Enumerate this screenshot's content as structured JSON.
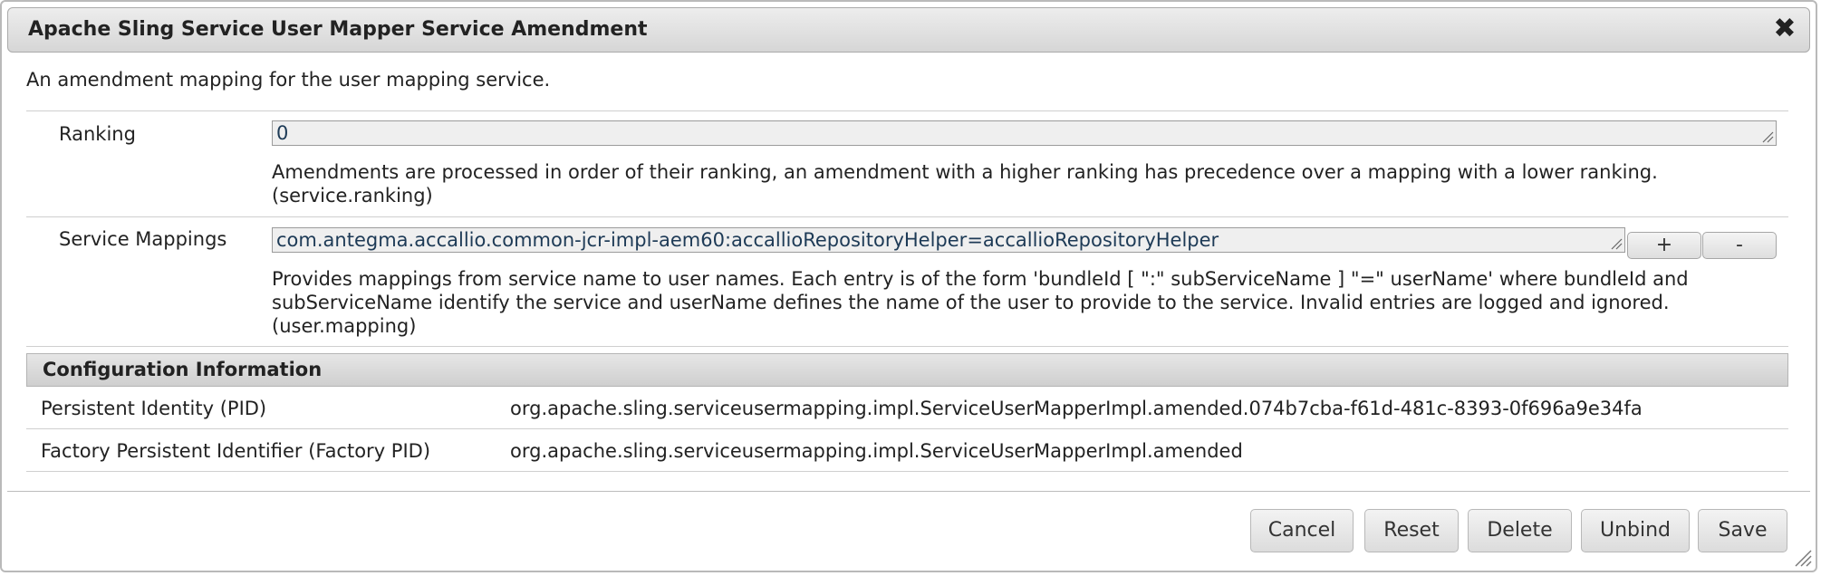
{
  "dialog": {
    "title": "Apache Sling Service User Mapper Service Amendment",
    "close_glyph": "✖",
    "description": "An amendment mapping for the user mapping service."
  },
  "ranking": {
    "label": "Ranking",
    "value": "0",
    "help_line1": "Amendments are processed in order of their ranking, an amendment with a higher ranking has precedence over a mapping with a lower ranking.",
    "help_line2": "(service.ranking)"
  },
  "service_mappings": {
    "label": "Service Mappings",
    "value": "com.antegma.accallio.common-jcr-impl-aem60:accallioRepositoryHelper=accallioRepositoryHelper",
    "add_label": "+",
    "remove_label": "-",
    "help_line1": "Provides mappings from service name to user names. Each entry is of the form 'bundleId [ \":\" subServiceName ] \"=\" userName' where bundleId and",
    "help_line2": "subServiceName identify the service and userName defines the name of the user to provide to the service. Invalid entries are logged and ignored.",
    "help_line3": "(user.mapping)"
  },
  "config_info": {
    "title": "Configuration Information",
    "pid_label": "Persistent Identity (PID)",
    "pid_value": "org.apache.sling.serviceusermapping.impl.ServiceUserMapperImpl.amended.074b7cba-f61d-481c-8393-0f696a9e34fa",
    "factory_pid_label": "Factory Persistent Identifier (Factory PID)",
    "factory_pid_value": "org.apache.sling.serviceusermapping.impl.ServiceUserMapperImpl.amended"
  },
  "buttons": {
    "cancel": "Cancel",
    "reset": "Reset",
    "delete": "Delete",
    "unbind": "Unbind",
    "save": "Save"
  }
}
